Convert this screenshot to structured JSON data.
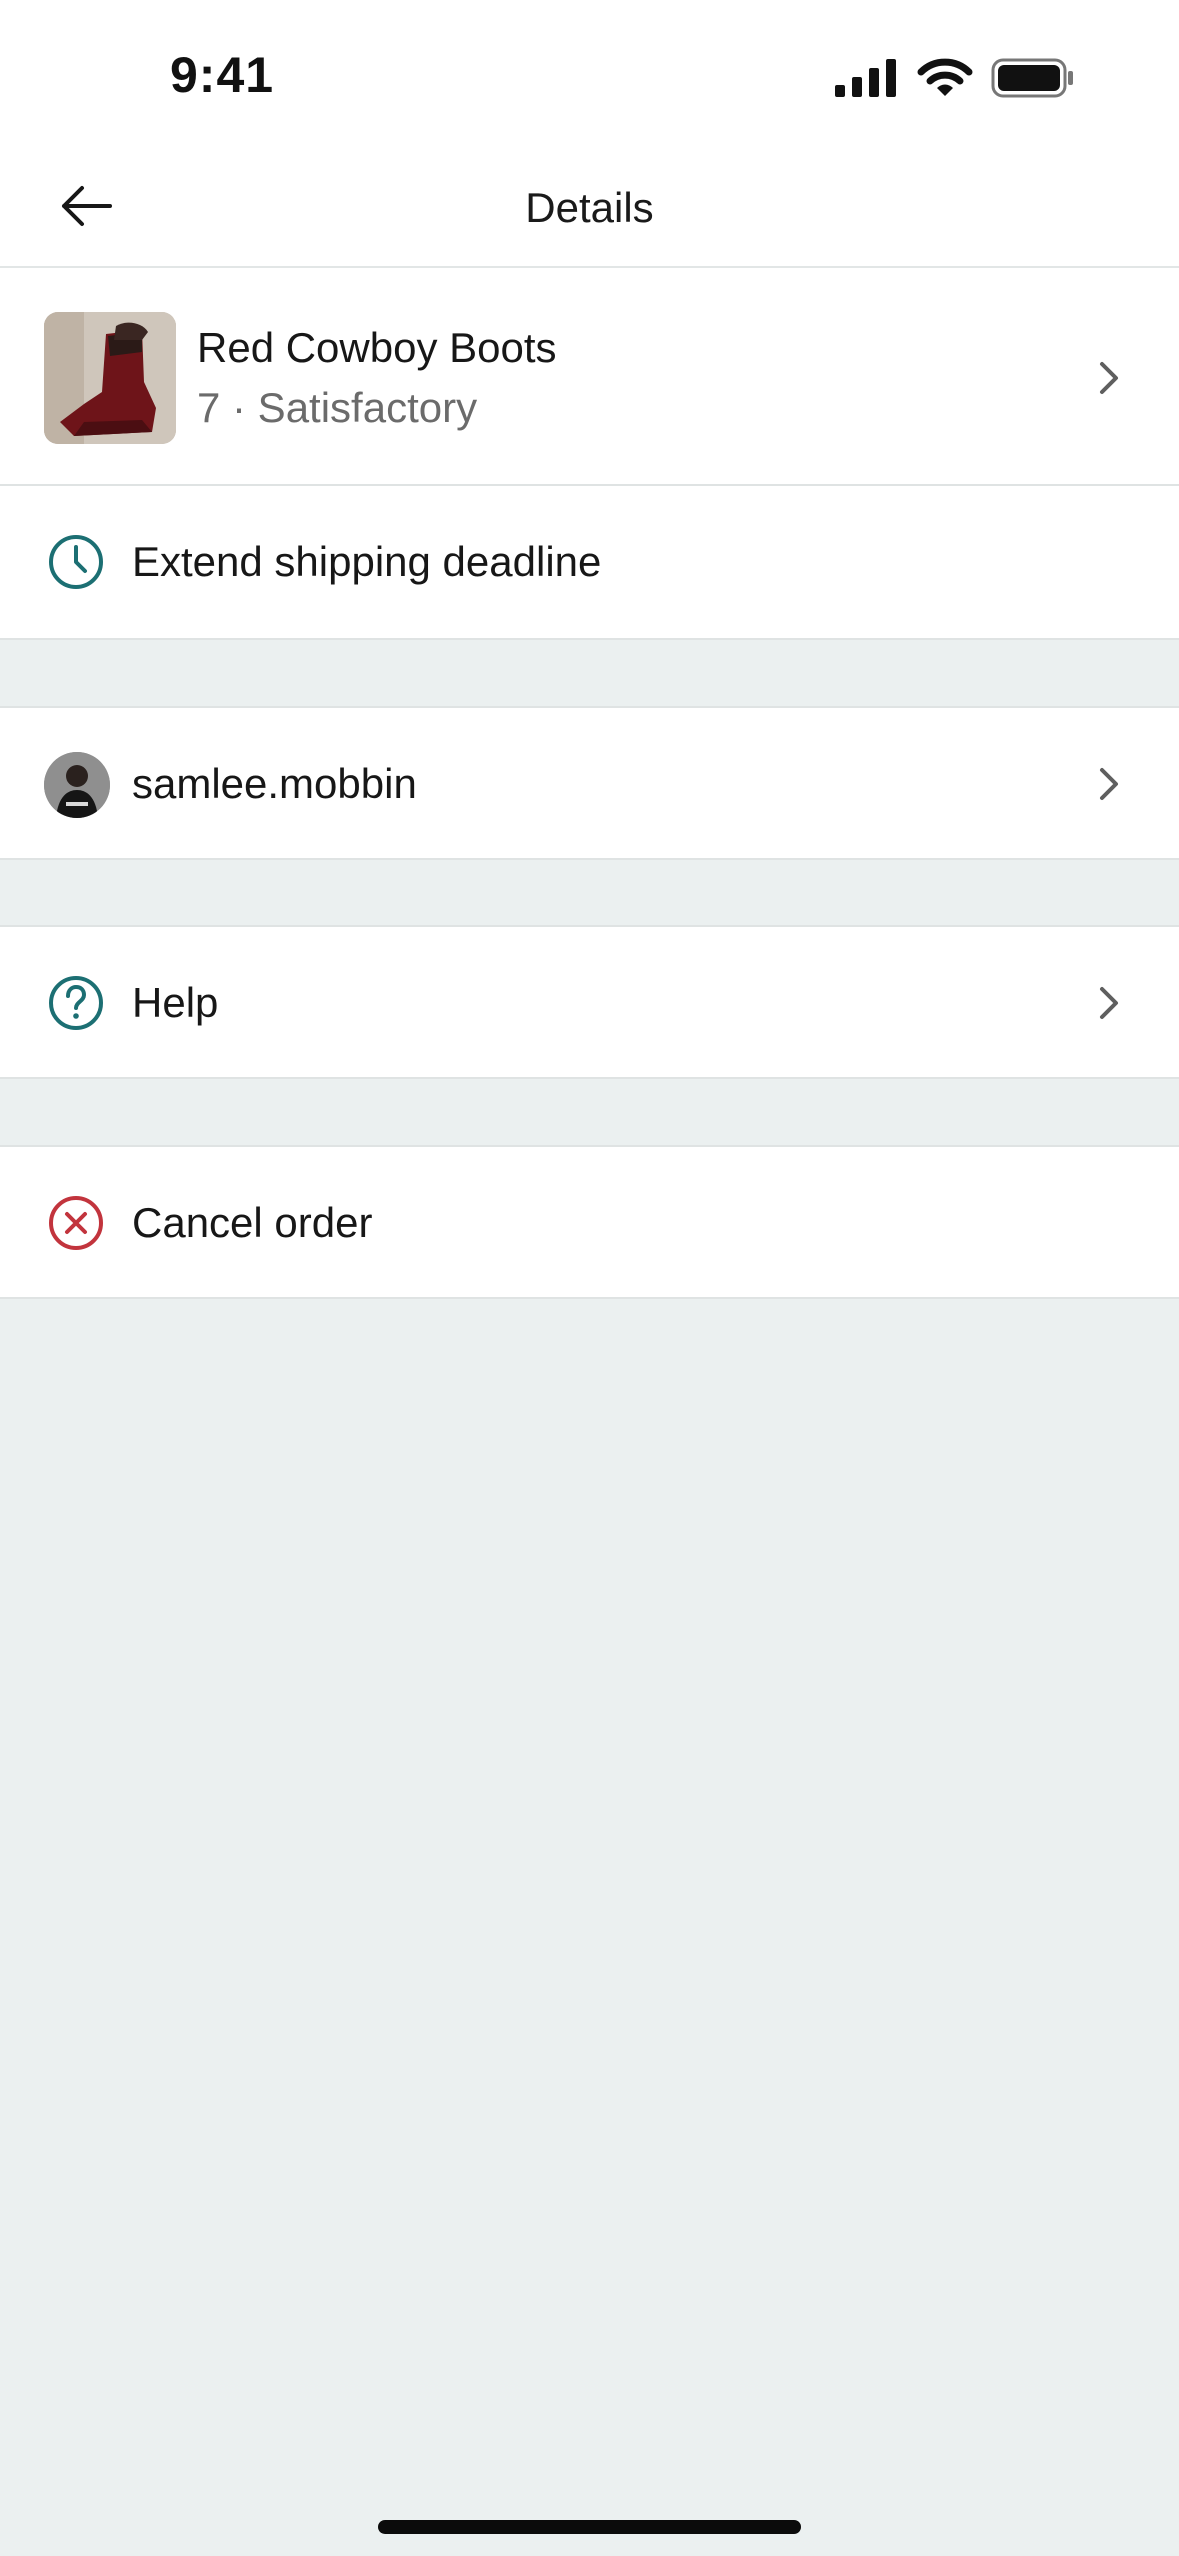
{
  "status_bar": {
    "time": "9:41",
    "icons": [
      "signal-icon",
      "wifi-icon",
      "battery-icon"
    ]
  },
  "nav": {
    "title": "Details",
    "back_icon": "arrow-left-icon"
  },
  "product": {
    "title": "Red Cowboy Boots",
    "subtitle": "7 · Satisfactory"
  },
  "actions": {
    "extend_label": "Extend shipping deadline",
    "user_label": "samlee.mobbin",
    "help_label": "Help",
    "cancel_label": "Cancel order"
  },
  "colors": {
    "accent_teal": "#1c6f73",
    "danger_red": "#c2343d",
    "background": "#ebf0f0",
    "chevron": "#5f5f5f"
  }
}
